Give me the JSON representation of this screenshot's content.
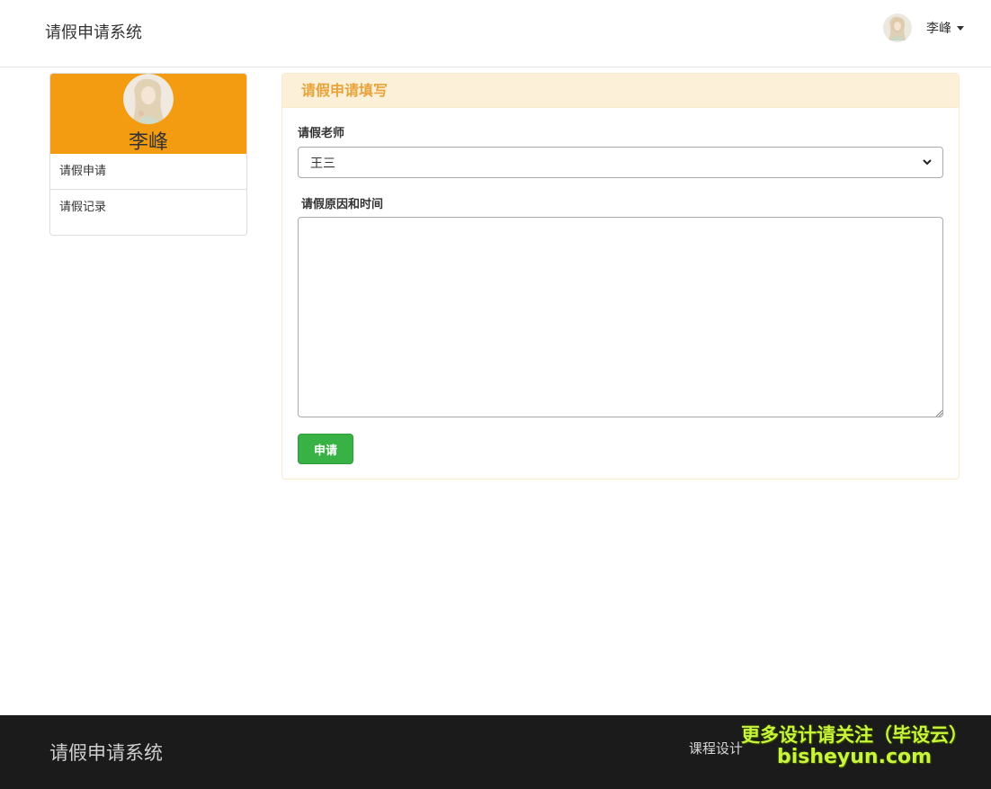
{
  "navbar": {
    "brand": "请假申请系统",
    "user_name": "李峰",
    "avatar_icon": "avatar-icon"
  },
  "sidebar": {
    "profile_name": "李峰",
    "header_color": "#f39c12",
    "items": [
      {
        "label": "请假申请"
      },
      {
        "label": "请假记录"
      }
    ]
  },
  "panel": {
    "title": "请假申请填写",
    "teacher_label": "请假老师",
    "teacher_selected": "王三",
    "reason_label": "请假原因和时间",
    "reason_value": "",
    "submit_label": "申请"
  },
  "footer": {
    "brand": "请假申请系统",
    "link": "课程设计",
    "watermark_line1": "更多设计请关注（毕设云）",
    "watermark_line2": "bisheyun.com"
  }
}
